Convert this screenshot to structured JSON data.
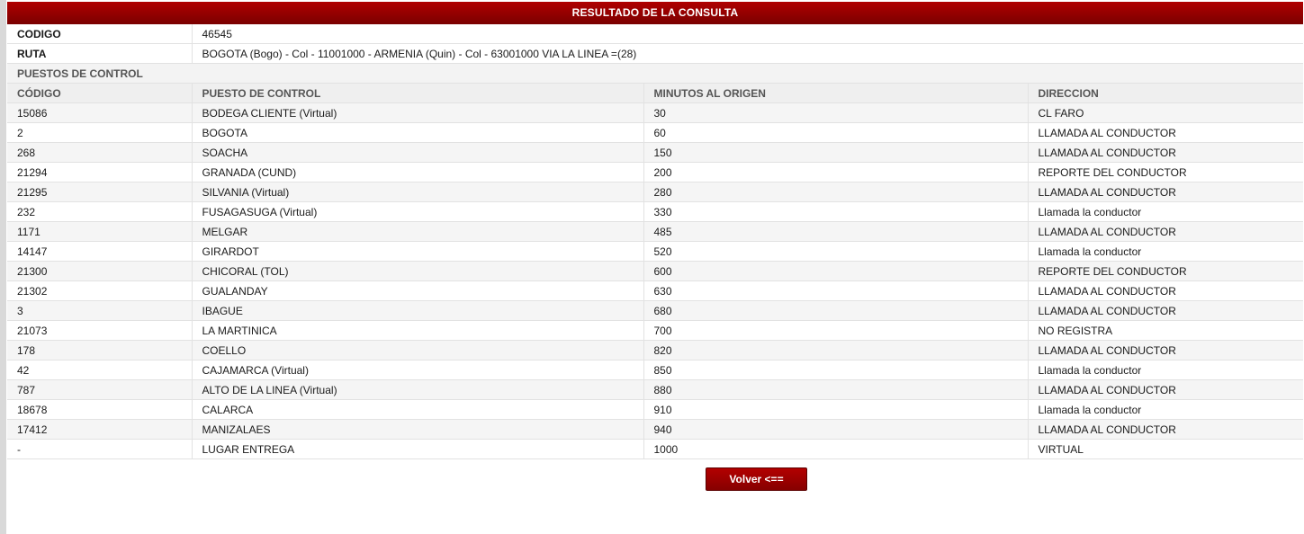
{
  "title": "RESULTADO DE LA CONSULTA",
  "info": {
    "codigo_label": "CODIGO",
    "codigo_value": "46545",
    "ruta_label": "RUTA",
    "ruta_value": "BOGOTA (Bogo) - Col - 11001000 - ARMENIA (Quin) - Col - 63001000 VIA LA LINEA =(28)"
  },
  "section_label": "PUESTOS DE CONTROL",
  "columns": [
    "CÓDIGO",
    "PUESTO DE CONTROL",
    "MINUTOS AL ORIGEN",
    "DIRECCION"
  ],
  "rows": [
    [
      "15086",
      "BODEGA CLIENTE (Virtual)",
      "30",
      "CL FARO"
    ],
    [
      "2",
      "BOGOTA",
      "60",
      "LLAMADA AL CONDUCTOR"
    ],
    [
      "268",
      "SOACHA",
      "150",
      "LLAMADA AL CONDUCTOR"
    ],
    [
      "21294",
      "GRANADA (CUND)",
      "200",
      "REPORTE DEL CONDUCTOR"
    ],
    [
      "21295",
      "SILVANIA (Virtual)",
      "280",
      "LLAMADA AL CONDUCTOR"
    ],
    [
      "232",
      "FUSAGASUGA (Virtual)",
      "330",
      "Llamada la conductor"
    ],
    [
      "1171",
      "MELGAR",
      "485",
      "LLAMADA AL CONDUCTOR"
    ],
    [
      "14147",
      "GIRARDOT",
      "520",
      "Llamada la conductor"
    ],
    [
      "21300",
      "CHICORAL (TOL)",
      "600",
      "REPORTE DEL CONDUCTOR"
    ],
    [
      "21302",
      "GUALANDAY",
      "630",
      "LLAMADA AL CONDUCTOR"
    ],
    [
      "3",
      "IBAGUE",
      "680",
      "LLAMADA AL CONDUCTOR"
    ],
    [
      "21073",
      "LA MARTINICA",
      "700",
      "NO REGISTRA"
    ],
    [
      "178",
      "COELLO",
      "820",
      "LLAMADA AL CONDUCTOR"
    ],
    [
      "42",
      "CAJAMARCA (Virtual)",
      "850",
      "Llamada la conductor"
    ],
    [
      "787",
      "ALTO DE LA LINEA (Virtual)",
      "880",
      "LLAMADA AL CONDUCTOR"
    ],
    [
      "18678",
      "CALARCA",
      "910",
      "Llamada la conductor"
    ],
    [
      "17412",
      "MANIZALAES",
      "940",
      "LLAMADA AL CONDUCTOR"
    ],
    [
      "-",
      "LUGAR ENTREGA",
      "1000",
      "VIRTUAL"
    ]
  ],
  "back_button": "Volver <=="
}
